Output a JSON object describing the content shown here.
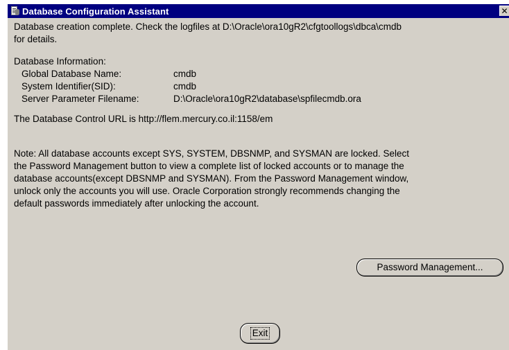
{
  "window": {
    "title": "Database Configuration Assistant",
    "close_glyph": "✕",
    "icon": "database-config-icon"
  },
  "message": {
    "complete_line1": "Database creation complete. Check the logfiles at D:\\Oracle\\ora10gR2\\cfgtoollogs\\dbca\\cmdb",
    "complete_line2": "for details.",
    "info_heading": "Database Information:",
    "info": [
      {
        "label": "Global Database Name:",
        "value": "cmdb"
      },
      {
        "label": "System Identifier(SID):",
        "value": "cmdb"
      },
      {
        "label": "Server Parameter Filename:",
        "value": "D:\\Oracle\\ora10gR2\\database\\spfilecmdb.ora"
      }
    ],
    "control_url": "The Database Control URL is http://flem.mercury.co.il:1158/em",
    "note_lines": [
      "Note: All database accounts except SYS, SYSTEM, DBSNMP, and SYSMAN are locked. Select",
      "the Password Management button to view a complete list of locked accounts or to manage the",
      "database accounts(except DBSNMP and SYSMAN). From the Password Management window,",
      "unlock only the accounts you will use. Oracle Corporation strongly recommends changing the",
      "default passwords immediately after unlocking the account."
    ]
  },
  "buttons": {
    "password_management": "Password Management...",
    "exit": "Exit"
  }
}
